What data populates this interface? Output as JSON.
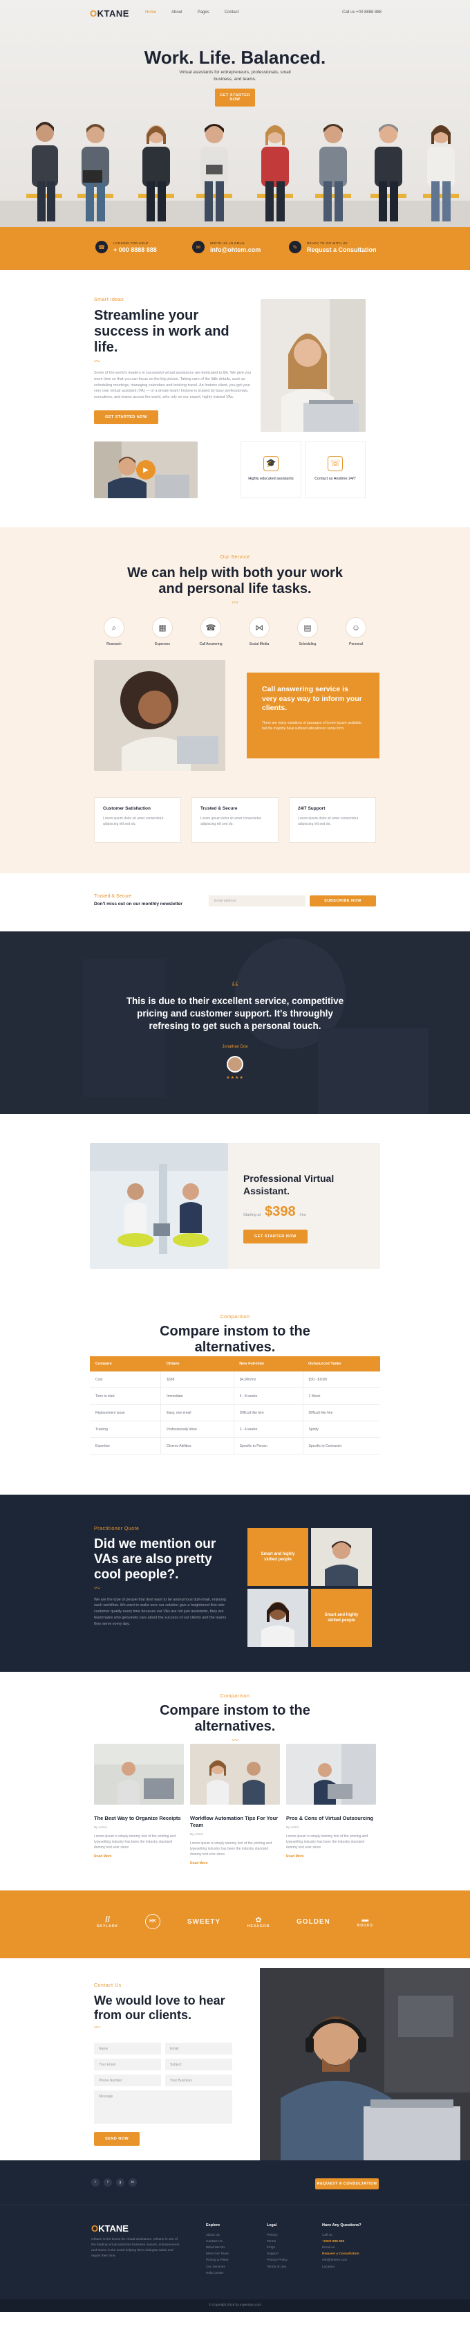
{
  "nav": {
    "logo_accent": "O",
    "logo_rest": "KTANE",
    "links": [
      "Home",
      "About",
      "Pages",
      "Contact"
    ],
    "phone": "Call us +00 8888 888"
  },
  "hero": {
    "title": "Work. Life. Balanced.",
    "subtitle": "Virtual assistants for entrepreneurs, professionals, small business, and teams.",
    "button": "Get started now"
  },
  "contact_bar": [
    {
      "label": "Looking for help",
      "value": "+ 000 8888 888",
      "icon": "phone-icon",
      "glyph": "☎"
    },
    {
      "label": "Write us an email",
      "value": "info@ohtem.com",
      "icon": "mail-icon",
      "glyph": "✉"
    },
    {
      "label": "Ready to go with us",
      "value": "Request a Consultation",
      "icon": "chat-icon",
      "glyph": "✎"
    }
  ],
  "about": {
    "kicker": "Smart Ideas",
    "title": "Streamline your success in work and life.",
    "body": "Some of the world's leaders in successful virtual assistance are dedicated to life. We give you more time so that you can focus on the big picture. Taking care of the little details, such as scheduling meetings, managing calendars and booking travel. An Instone client, you get your very own virtual assistant (VA) — or a dream team! Instone is trusted by busy professionals, executives, and teams across the world, who rely on our expert, highly trained VAs.",
    "button": "Get started now",
    "minis": [
      {
        "title": "Highly educated assistants",
        "icon": "graduation-cap-icon",
        "glyph": "🎓"
      },
      {
        "title": "Contact us Anytime 24/7",
        "icon": "phone-call-icon",
        "glyph": "☏"
      }
    ]
  },
  "services": {
    "kicker": "Our Service",
    "title": "We can help with both your work and personal life tasks.",
    "items": [
      {
        "label": "Research",
        "icon": "search-icon",
        "glyph": "⌕"
      },
      {
        "label": "Expenses",
        "icon": "calculator-icon",
        "glyph": "▦"
      },
      {
        "label": "Call Answering",
        "icon": "headset-icon",
        "glyph": "☎"
      },
      {
        "label": "Social Media",
        "icon": "share-icon",
        "glyph": "⋈"
      },
      {
        "label": "Scheduling",
        "icon": "calendar-icon",
        "glyph": "▤"
      },
      {
        "label": "Personal",
        "icon": "user-icon",
        "glyph": "☺"
      }
    ],
    "callbox": {
      "title": "Call answering service is very easy way to inform your clients.",
      "desc": "There are many variations of passages of Lorem Ipsum available, but the majority have suffered alteration in some form."
    },
    "features": [
      {
        "title": "Customer Satisfaction",
        "desc": "Lorem ipsum dolor sit amet consectetur adipiscing elit sed do."
      },
      {
        "title": "Trusted & Secure",
        "desc": "Lorem ipsum dolor sit amet consectetur adipiscing elit sed do."
      },
      {
        "title": "24/7 Support",
        "desc": "Lorem ipsum dolor sit amet consectetur adipiscing elit sed do."
      }
    ]
  },
  "newsletter": {
    "kicker": "Trusted & Secure",
    "title": "Don't miss out on our monthly newsletter",
    "placeholder": "Email address",
    "button": "Subscribe now"
  },
  "testimonial": {
    "quote_mark": "“",
    "text": "This is due to their excellent service, competitive pricing and customer support. It's throughly refresing to get such a personal touch.",
    "name": "Jonathan Doe",
    "stars": "★★★★"
  },
  "pricing": {
    "title": "Professional Virtual Assistant.",
    "starting": "Starting at",
    "price": "$398",
    "per": "/mo",
    "button": "Get started now"
  },
  "compare": {
    "kicker": "Comparison",
    "title": "Compare instom to the alternatives.",
    "headers": [
      "Compare",
      "Ohtane",
      "New Full-time",
      "Outsourced Tasks"
    ],
    "rows": [
      [
        "Cost",
        "$398",
        "$4,000/mo",
        "$30 - $1000"
      ],
      [
        "Time to start",
        "Immediate",
        "4 - 8 weeks",
        "1 Week"
      ],
      [
        "Replacement issue",
        "Easy, one email",
        "Difficult like hire",
        "Difficult like hire"
      ],
      [
        "Training",
        "Professionally done",
        "2 - 4 weeks",
        "Spotty"
      ],
      [
        "Expertise",
        "Diverse Abilities",
        "Specific to Person",
        "Specific to Contractor"
      ]
    ]
  },
  "vas": {
    "kicker": "Practitioner Quote",
    "title": "Did we mention our VAs are also pretty cool people?.",
    "body": "We are the type of people that dont want to be anonymous dull email, enjoying each workflow. We want to make sure our solution give a heightened first-rate customer quality every time because our VAs are not just assistants, they are teammates who genuinely care about the success of our clients and the teams they serve every day.",
    "tile1": "Smart and highly skilled people",
    "tile2": "Smart and highly skilled people"
  },
  "blog": {
    "kicker": "Comparison",
    "title": "Compare instom to the alternatives.",
    "posts": [
      {
        "title": "The Best Way to Organize Receipts",
        "meta": "By Admin",
        "desc": "Lorem ipsum is simply dummy text of the printing and typesetting industry has been the industry standard dummy text ever since.",
        "more": "Read More"
      },
      {
        "title": "Workflow Automation Tips For Your Team",
        "meta": "By Admin",
        "desc": "Lorem ipsum is simply dummy text of the printing and typesetting industry has been the industry standard dummy text ever since.",
        "more": "Read More"
      },
      {
        "title": "Pros & Cons of Virtual Outsourcing",
        "meta": "By Admin",
        "desc": "Lorem ipsum is simply dummy text of the printing and typesetting industry has been the industry standard dummy text ever since.",
        "more": "Read More"
      }
    ]
  },
  "logos": [
    {
      "name": "SKYLARK",
      "mark": "//"
    },
    {
      "name": "HK",
      "mark": "HK"
    },
    {
      "name": "SWEETY",
      "mark": "✦"
    },
    {
      "name": "HEXAGON",
      "mark": "✿"
    },
    {
      "name": "GOLDEN",
      "mark": "GOLDEN"
    },
    {
      "name": "BOOKS",
      "mark": "▬"
    }
  ],
  "contact": {
    "kicker": "Contact Us",
    "title": "We would love to hear from our clients.",
    "fields": [
      "Name",
      "Email",
      "Your Email",
      "Subject",
      "Phone Number",
      "Your Business",
      "Message"
    ],
    "button": "Send now"
  },
  "strip": {
    "social": [
      "t",
      "f",
      "g",
      "in"
    ],
    "button": "Request a consultation"
  },
  "footer": {
    "logo_accent": "O",
    "logo_rest": "KTANE",
    "about": "Ohtane is the brand for virtual assistance. Ohtane is one of the leading virtual assistant business owners, entrepreneurs and teams in the world helping them delegate tasks and regain their time.",
    "cols": [
      {
        "heading": "Explore",
        "items": [
          "About Us",
          "Contact Us",
          "What We Do",
          "Meet Our Team",
          "Pricing & Plans",
          "Our Services",
          "Help Center"
        ]
      },
      {
        "heading": "Legal",
        "items": [
          "Privacy",
          "Terms",
          "FAQs",
          "Support",
          "Privacy Policy",
          "Terms of Use"
        ]
      },
      {
        "heading": "Have Any Questions?",
        "items": [
          "Call us",
          "+0000 888 888",
          "Email us",
          "Request a Consultation",
          "info@ohtem.com",
          "Location"
        ]
      }
    ],
    "copyright": "© Copyright 2018 by ingenioyo.com"
  },
  "colors": {
    "accent": "#e8942a",
    "navy": "#1d2637"
  }
}
